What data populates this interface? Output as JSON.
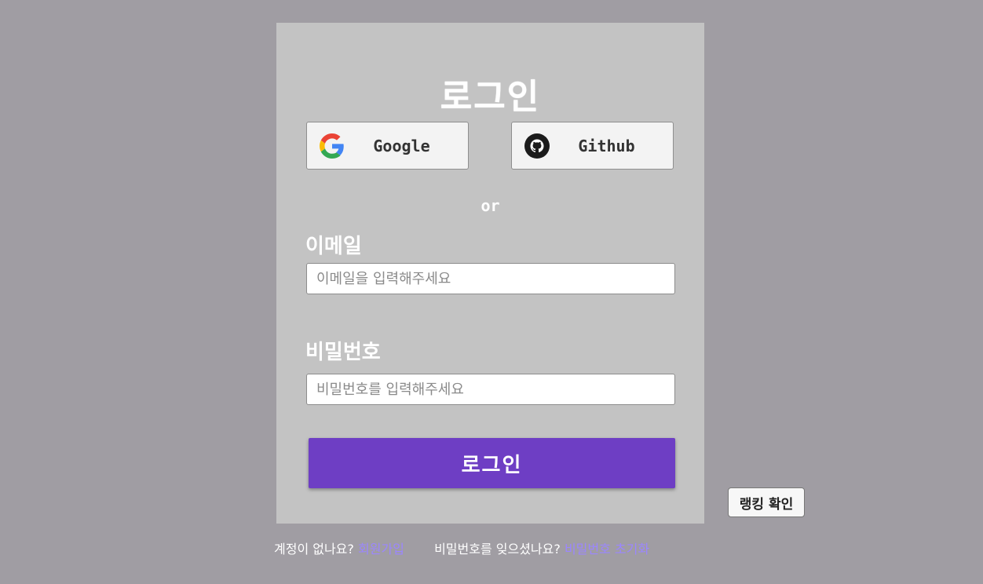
{
  "card": {
    "title": "로그인"
  },
  "social": {
    "google_label": "Google",
    "github_label": "Github"
  },
  "divider": "or",
  "email": {
    "label": "이메일",
    "placeholder": "이메일을 입력해주세요",
    "value": ""
  },
  "password": {
    "label": "비밀번호",
    "placeholder": "비밀번호를 입력해주세요",
    "value": ""
  },
  "login_button": "로그인",
  "ranking_button": "랭킹 확인",
  "footer": {
    "no_account_text": "계정이 없나요?",
    "signup_link": "회원가입",
    "forgot_text": "비밀번호를 잊으셨나요?",
    "reset_link": "비밀번호 초기화"
  },
  "colors": {
    "background": "#a09da3",
    "card": "#c3c3c3",
    "primary": "#6e3ec4",
    "link": "#9b86ff"
  },
  "icons": [
    "google-icon",
    "github-icon"
  ]
}
